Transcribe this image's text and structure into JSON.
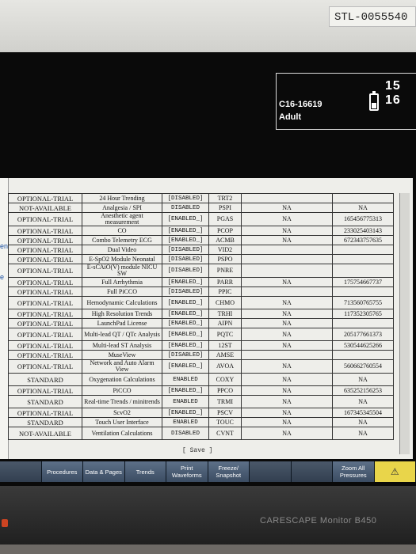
{
  "device": {
    "asset_tag": "STL-0055540",
    "brand": "CARESCAPE Monitor B450"
  },
  "header": {
    "patient_id": "C16-16619",
    "patient_category": "Adult",
    "time": "15 16"
  },
  "left_labels": [
    "ent",
    "e"
  ],
  "table": {
    "rows": [
      [
        "OPTIONAL-TRIAL",
        "24 Hour Trending",
        "[DISABLED]",
        "TRT2",
        "",
        ""
      ],
      [
        "NOT-AVAILABLE",
        "Analgesia / SPI",
        "DISABLED",
        "PSPI",
        "NA",
        "NA"
      ],
      [
        "OPTIONAL-TRIAL",
        "Anesthetic agent measurement",
        "[ENABLED_]",
        "PGAS",
        "NA",
        "165456775313"
      ],
      [
        "OPTIONAL-TRIAL",
        "CO",
        "[ENABLED_]",
        "PCOP",
        "NA",
        "233025403143"
      ],
      [
        "OPTIONAL-TRIAL",
        "Combo Telemetry ECG",
        "[ENABLED_]",
        "ACMB",
        "NA",
        "672343757635"
      ],
      [
        "OPTIONAL-TRIAL",
        "Dual Video",
        "[DISABLED]",
        "VID2",
        "",
        ""
      ],
      [
        "OPTIONAL-TRIAL",
        "E-SpO2 Module Neonatal",
        "[DISABLED]",
        "PSPO",
        "",
        ""
      ],
      [
        "OPTIONAL-TRIAL",
        "E-sCAiO(V) module NICU SW",
        "[DISABLED]",
        "PNRE",
        "",
        ""
      ],
      [
        "OPTIONAL-TRIAL",
        "Full Arrhythmia",
        "[ENABLED_]",
        "PARR",
        "NA",
        "175754667737"
      ],
      [
        "OPTIONAL-TRIAL",
        "Full PiCCO",
        "[DISABLED]",
        "PPIC",
        "",
        ""
      ],
      [
        "OPTIONAL-TRIAL",
        "Hemodynamic Calculations",
        "[ENABLED_]",
        "CHMO",
        "NA",
        "713560765755"
      ],
      [
        "OPTIONAL-TRIAL",
        "High Resolution Trends",
        "[ENABLED_]",
        "TRHI",
        "NA",
        "117352305765"
      ],
      [
        "OPTIONAL-TRIAL",
        "LaunchPad License",
        "[ENABLED_]",
        "AIPN",
        "NA",
        ""
      ],
      [
        "OPTIONAL-TRIAL",
        "Multi-lead QT / QTc Analysis",
        "[ENABLED_]",
        "PQTC",
        "NA",
        "205177661373"
      ],
      [
        "OPTIONAL-TRIAL",
        "Multi-lead ST Analysis",
        "[ENABLED_]",
        "12ST",
        "NA",
        "530544625266"
      ],
      [
        "OPTIONAL-TRIAL",
        "MuseView",
        "[DISABLED]",
        "AMSE",
        "",
        ""
      ],
      [
        "OPTIONAL-TRIAL",
        "Network and Auto Alarm View",
        "[ENABLED_]",
        "AVOA",
        "NA",
        "560662760554"
      ],
      [
        "STANDARD",
        "Oxygenation Calculations",
        "ENABLED",
        "COXY",
        "NA",
        "NA"
      ],
      [
        "OPTIONAL-TRIAL",
        "PiCCO",
        "[ENABLED_]",
        "PPCO",
        "NA",
        "635252156253"
      ],
      [
        "STANDARD",
        "Real-time Trends / minitrends",
        "ENABLED",
        "TRMI",
        "NA",
        "NA"
      ],
      [
        "OPTIONAL-TRIAL",
        "ScvO2",
        "[ENABLED_]",
        "PSCV",
        "NA",
        "167345345504"
      ],
      [
        "STANDARD",
        "Touch User Interface",
        "ENABLED",
        "TOUC",
        "NA",
        "NA"
      ],
      [
        "NOT-AVAILABLE",
        "Ventilation Calculations",
        "DISABLED",
        "CVNT",
        "NA",
        "NA"
      ]
    ],
    "save_label": "[ Save ]"
  },
  "softkeys": [
    {
      "label": "",
      "state": "dim"
    },
    {
      "label": "Procedures",
      "state": "normal"
    },
    {
      "label": "Data & Pages",
      "state": "normal"
    },
    {
      "label": "Trends",
      "state": "normal"
    },
    {
      "label": "Print Waveforms",
      "state": "normal"
    },
    {
      "label": "Freeze/ Snapshot",
      "state": "normal"
    },
    {
      "label": "",
      "state": "dim"
    },
    {
      "label": "",
      "state": "dim"
    },
    {
      "label": "Zoom All Pressures",
      "state": "normal"
    },
    {
      "label": "",
      "state": "alarm"
    }
  ],
  "colors": {
    "screen_bg": "#0a0a0a",
    "panel_bg": "#eeeeea",
    "softkey_bg": "#3b4c62",
    "alarm_key": "#e9d54a"
  }
}
